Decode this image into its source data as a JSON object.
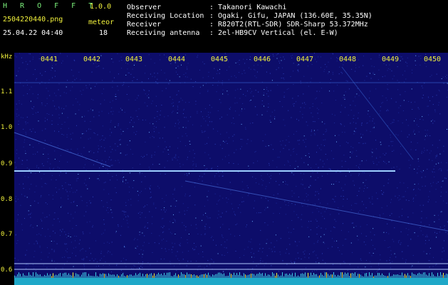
{
  "header": {
    "app_name": "H R O F F T",
    "app_version": "1.0.0",
    "filename": "2504220440.png",
    "datetime": "25.04.22 04:40",
    "meteor_label": "meteor",
    "meteor_count": "18",
    "meta": [
      {
        "label": "Observer",
        "value": ": Takanori Kawachi"
      },
      {
        "label": "Receiving Location",
        "value": ": Ogaki, Gifu, JAPAN (136.60E, 35.35N)"
      },
      {
        "label": "Receiver",
        "value": ": R820T2(RTL-SDR) SDR-Sharp 53.372MHz"
      },
      {
        "label": "Receiving antenna",
        "value": ": 2el-HB9CV Vertical (el. E-W)"
      }
    ]
  },
  "axis": {
    "y_unit": "kHz",
    "y_ticks": [
      "1.1",
      "1.0",
      "0.9",
      "0.8",
      "0.7",
      "0.6"
    ],
    "x_ticks": [
      "0441",
      "0442",
      "0443",
      "0444",
      "0445",
      "0446",
      "0447",
      "0448",
      "0449",
      "0450"
    ]
  },
  "colors": {
    "background": "#000000",
    "spectrogram": "#0d0d6a",
    "label_green": "#7cf27c",
    "label_yellow": "#f2f23c",
    "carrier": "#9fd0ff"
  }
}
